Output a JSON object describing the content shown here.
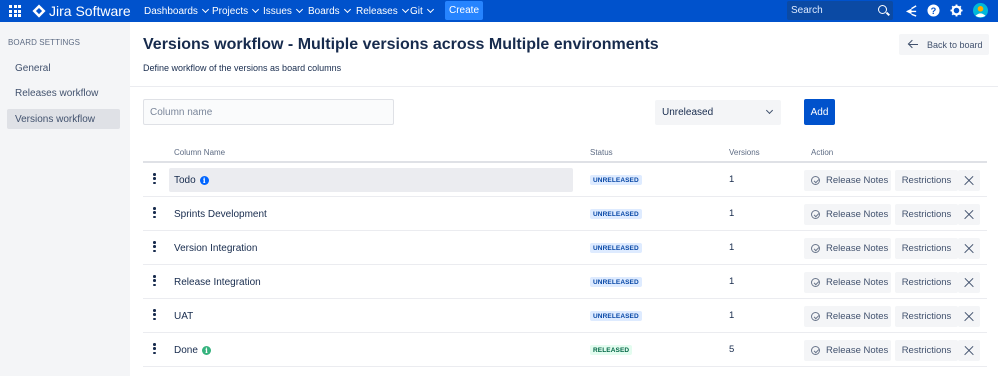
{
  "topnav": {
    "app_name": "Jira Software",
    "menus": [
      "Dashboards",
      "Projects",
      "Issues",
      "Boards",
      "Releases",
      "Git"
    ],
    "create_label": "Create",
    "search_placeholder": "Search",
    "colors": {
      "bar": "#0052cc",
      "create": "#2684ff"
    }
  },
  "sidebar": {
    "heading": "BOARD SETTINGS",
    "items": [
      {
        "label": "General"
      },
      {
        "label": "Releases workflow"
      },
      {
        "label": "Versions workflow",
        "active": true
      }
    ]
  },
  "page": {
    "title": "Versions workflow - Multiple versions across Multiple environments",
    "subtitle": "Define workflow of the versions as board columns",
    "back_label": "Back to board"
  },
  "form": {
    "column_name_placeholder": "Column name",
    "column_name_value": "",
    "status_selected": "Unreleased",
    "add_label": "Add"
  },
  "table": {
    "headers": {
      "name": "Column Name",
      "status": "Status",
      "versions": "Versions",
      "action": "Action"
    },
    "action_labels": {
      "release_notes": "Release Notes",
      "restrictions": "Restrictions"
    },
    "rows": [
      {
        "name": "Todo",
        "info": true,
        "info_color": "#0065ff",
        "status": "UNRELEASED",
        "versions": "1",
        "highlight": true
      },
      {
        "name": "Sprints Development",
        "info": false,
        "status": "UNRELEASED",
        "versions": "1"
      },
      {
        "name": "Version Integration",
        "info": false,
        "status": "UNRELEASED",
        "versions": "1"
      },
      {
        "name": "Release Integration",
        "info": false,
        "status": "UNRELEASED",
        "versions": "1"
      },
      {
        "name": "UAT",
        "info": false,
        "status": "UNRELEASED",
        "versions": "1"
      },
      {
        "name": "Done",
        "info": true,
        "info_color": "#36b37e",
        "status": "RELEASED",
        "versions": "5"
      }
    ],
    "status_colors": {
      "UNRELEASED": {
        "bg": "#deebff",
        "fg": "#0747a6"
      },
      "RELEASED": {
        "bg": "#e3fcef",
        "fg": "#006644"
      }
    }
  }
}
